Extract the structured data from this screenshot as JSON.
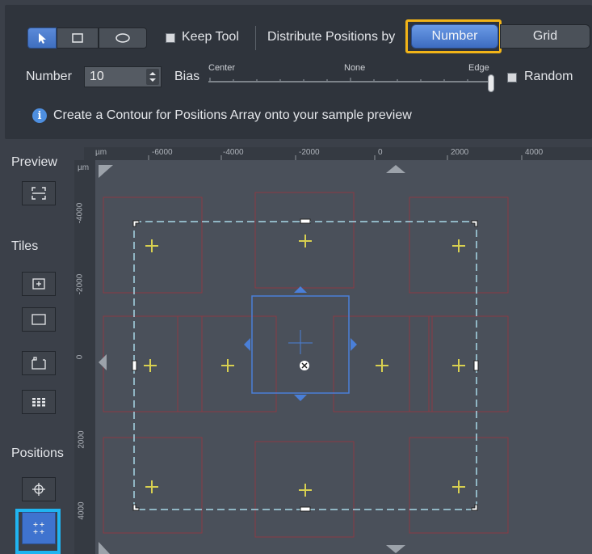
{
  "toolbar": {
    "keep_tool_label": "Keep Tool",
    "distribute_label": "Distribute Positions by",
    "number_button": "Number",
    "grid_button": "Grid",
    "number_label": "Number",
    "number_value": "10",
    "bias_label": "Bias",
    "bias_center": "Center",
    "bias_none": "None",
    "bias_edge": "Edge",
    "bias_value": 1.0,
    "random_label": "Random",
    "info_text": "Create a Contour for Positions Array onto your sample preview",
    "info_icon": "i"
  },
  "ruler": {
    "unit": "µm",
    "h_ticks": [
      "-6000",
      "-4000",
      "-2000",
      "0",
      "2000",
      "4000"
    ],
    "v_ticks": [
      "-4000",
      "-2000",
      "0",
      "2000",
      "4000"
    ]
  },
  "sidebar": {
    "preview_label": "Preview",
    "tiles_label": "Tiles",
    "positions_label": "Positions"
  },
  "colors": {
    "accent": "#4a7fd8",
    "highlight_orange": "#f2b418",
    "highlight_cyan": "#20b4f0",
    "marker_yellow": "#d8d050",
    "contour": "#a8d8e8",
    "tile_red": "#8a3a44"
  }
}
